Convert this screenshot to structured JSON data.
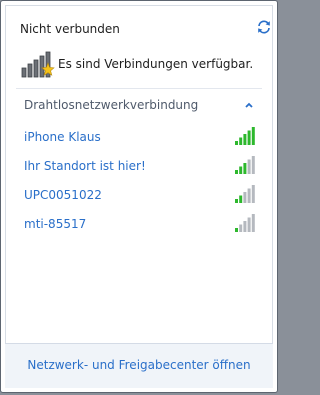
{
  "header": {
    "title": "Nicht verbunden",
    "refresh_icon": "refresh-icon"
  },
  "status": {
    "icon": "network-available-icon",
    "text": "Es sind Verbindungen verfügbar."
  },
  "section": {
    "label": "Drahtlosnetzwerkverbindung",
    "collapse_icon": "chevron-up-icon"
  },
  "networks": [
    {
      "name": "iPhone Klaus",
      "signal_bars": 5,
      "signal_color": "#2db82d"
    },
    {
      "name": "Ihr Standort ist hier!",
      "signal_bars": 3,
      "signal_color": "#2db82d"
    },
    {
      "name": "UPC0051022",
      "signal_bars": 2,
      "signal_color": "#2db82d"
    },
    {
      "name": "mti-85517",
      "signal_bars": 1,
      "signal_color": "#2db82d"
    }
  ],
  "footer": {
    "link_text": "Netzwerk- und Freigabecenter öffnen"
  },
  "colors": {
    "link": "#2a6fc9",
    "signal_active": "#2db82d",
    "signal_inactive": "#b5b9bf"
  }
}
